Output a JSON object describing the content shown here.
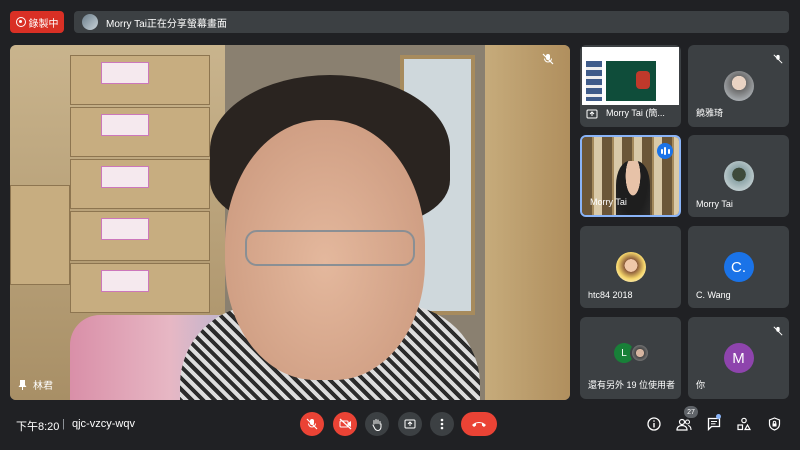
{
  "top": {
    "record_label": "錄製中",
    "share_text": "Morry Tai正在分享螢幕畫面"
  },
  "main": {
    "speaker_name": "林君"
  },
  "tiles": [
    {
      "name": "Morry Tai (簡..."
    },
    {
      "name": "饒雅琦"
    },
    {
      "name": "Morry Tai"
    },
    {
      "name": "Morry Tai"
    },
    {
      "name": "htc84 2018"
    },
    {
      "name": "C. Wang",
      "initial": "C."
    },
    {
      "name": "還有另外 19 位使用者",
      "initial": "L"
    },
    {
      "name": "你",
      "initial": "M"
    }
  ],
  "bottom": {
    "time": "下午8:20",
    "separator": "|",
    "meeting_code": "qjc-vzcy-wqv",
    "participants_count": "27"
  },
  "colors": {
    "background": "#202124",
    "tile": "#3c4043",
    "red": "#ea4335",
    "accent_blue": "#1a73e8"
  }
}
